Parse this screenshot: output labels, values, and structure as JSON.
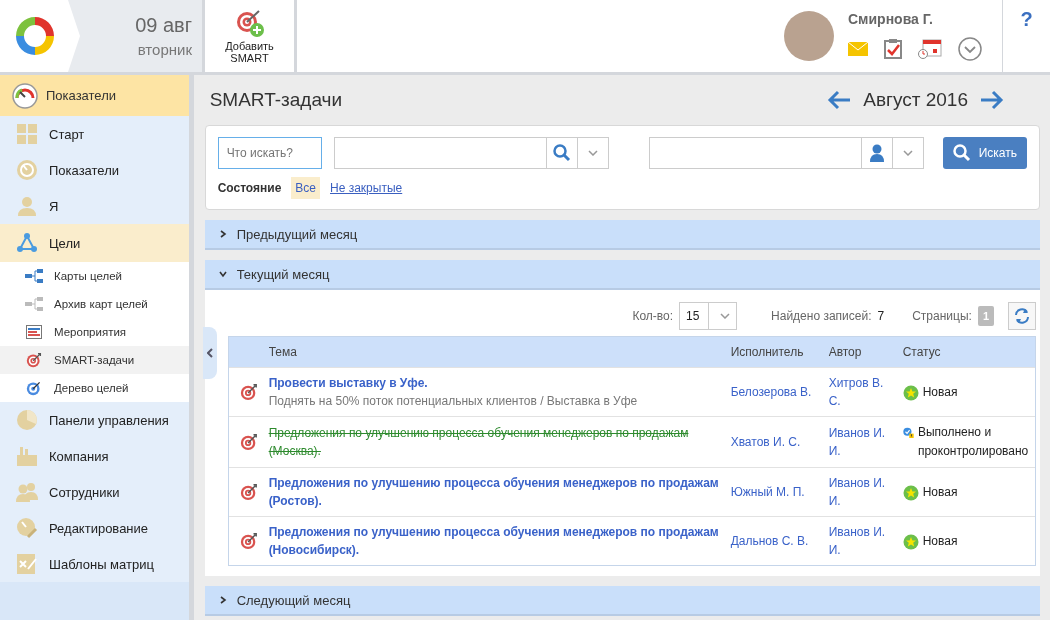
{
  "header": {
    "date": "09 авг",
    "weekday": "вторник",
    "add_button": "Добавить SMART",
    "user": "Смирнова Г.",
    "help": "?"
  },
  "sidebar": {
    "header": "Показатели",
    "items": [
      {
        "label": "Старт",
        "selected": false
      },
      {
        "label": "Показатели",
        "selected": false
      },
      {
        "label": "Я",
        "selected": false
      },
      {
        "label": "Цели",
        "selected": false,
        "expanded": true,
        "children": [
          {
            "label": "Карты целей",
            "selected": false
          },
          {
            "label": "Архив карт целей",
            "selected": false
          },
          {
            "label": "Мероприятия",
            "selected": false
          },
          {
            "label": "SMART-задачи",
            "selected": true
          },
          {
            "label": "Дерево целей",
            "selected": false
          }
        ]
      },
      {
        "label": "Панели управления",
        "selected": false
      },
      {
        "label": "Компания",
        "selected": false
      },
      {
        "label": "Сотрудники",
        "selected": false
      },
      {
        "label": "Редактирование",
        "selected": false
      },
      {
        "label": "Шаблоны матриц",
        "selected": false
      }
    ]
  },
  "page": {
    "title": "SMART-задачи",
    "period": "Август 2016"
  },
  "filter": {
    "placeholder": "Что искать?",
    "state_label": "Состояние",
    "states": [
      {
        "label": "Все",
        "selected": true
      },
      {
        "label": "Не закрытые",
        "selected": false
      }
    ],
    "search_button": "Искать"
  },
  "sections": [
    {
      "title": "Предыдущий месяц",
      "expanded": false
    },
    {
      "title": "Текущий месяц",
      "expanded": true,
      "pager": {
        "count_label": "Кол-во:",
        "count": "15",
        "found_label": "Найдено записей:",
        "found": "7",
        "pages_label": "Страницы:",
        "page": "1"
      },
      "table": {
        "columns": [
          "Тема",
          "Исполнитель",
          "Автор",
          "Статус"
        ],
        "rows": [
          {
            "title": "Провести выставку в Уфе.",
            "subtitle": "Поднять на 50% поток потенциальных клиентов / Выставка в Уфе",
            "done": false,
            "executor": "Белозерова В.",
            "author": "Хитров В. С.",
            "status": {
              "kind": "new",
              "label": "Новая"
            }
          },
          {
            "title": "Предложения по улучшению процесса обучения менеджеров по продажам (Москва).",
            "done": true,
            "executor": "Хватов И. С.",
            "author": "Иванов И. И.",
            "status": {
              "kind": "done",
              "label": "Выполнено и проконтролировано"
            }
          },
          {
            "title": "Предложения по улучшению процесса обучения менеджеров по продажам (Ростов).",
            "done": false,
            "executor": "Южный М. П.",
            "author": "Иванов И. И.",
            "status": {
              "kind": "new",
              "label": "Новая"
            }
          },
          {
            "title": "Предложения по улучшению процесса обучения менеджеров по продажам (Новосибирск).",
            "done": false,
            "executor": "Дальнов С. В.",
            "author": "Иванов И. И.",
            "status": {
              "kind": "new",
              "label": "Новая"
            }
          }
        ]
      }
    },
    {
      "title": "Следующий месяц",
      "expanded": false
    }
  ]
}
